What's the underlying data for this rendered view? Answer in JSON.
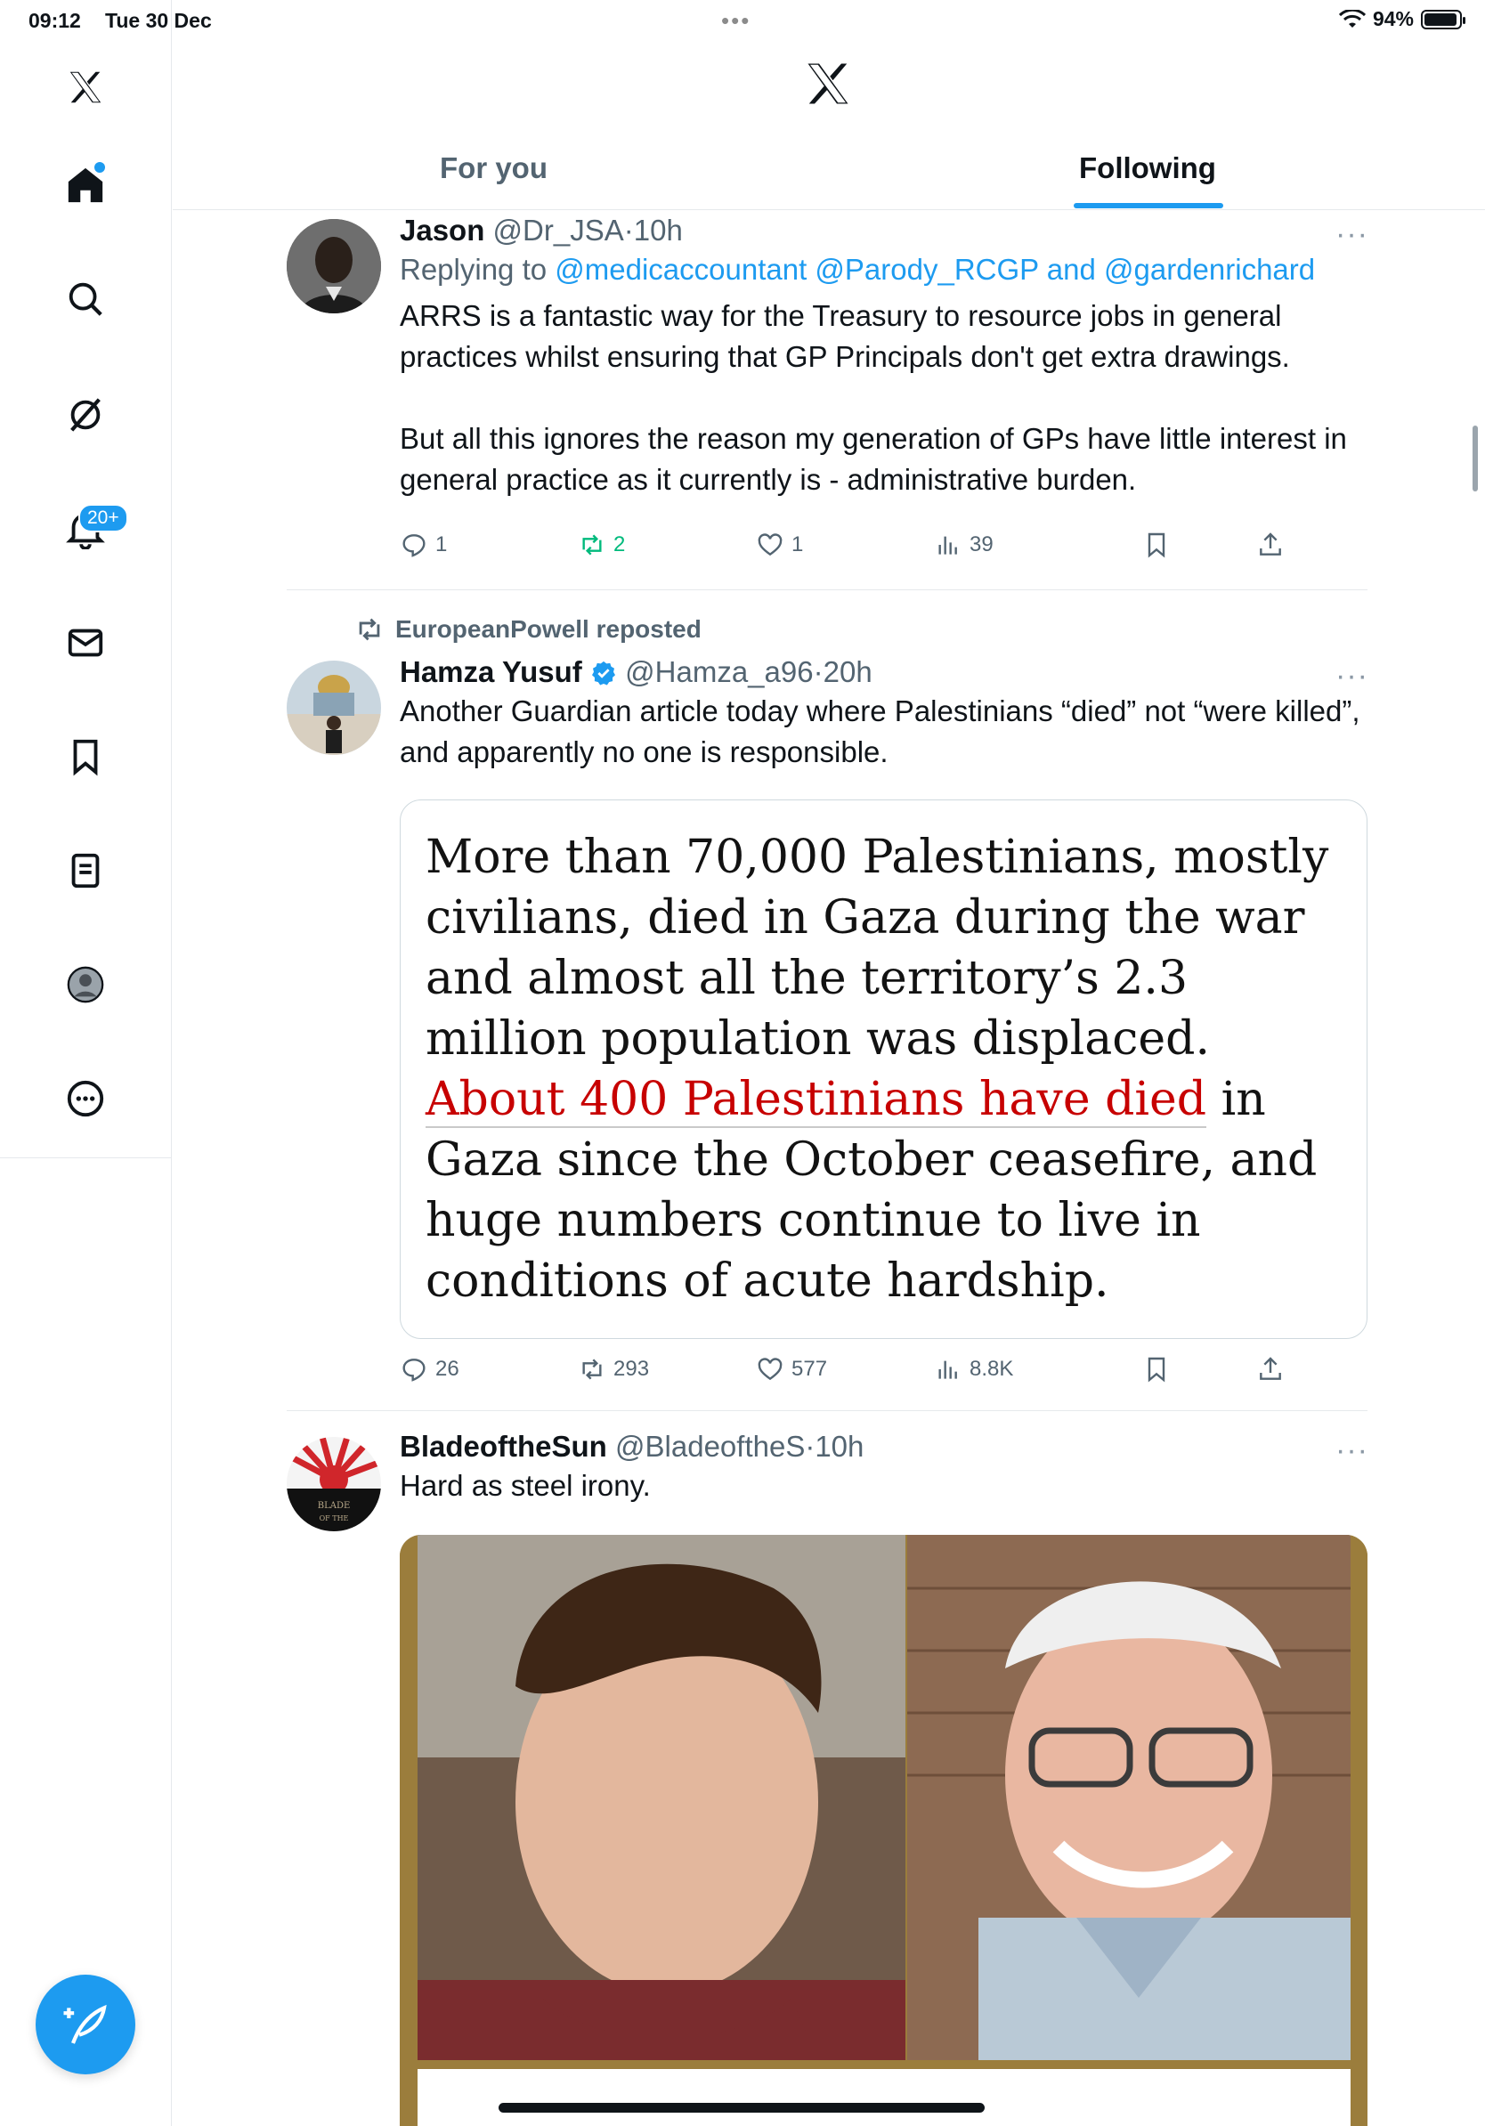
{
  "status_bar": {
    "time": "09:12",
    "date": "Tue 30 Dec",
    "battery": "94%",
    "battery_level": 0.94
  },
  "header": {
    "logo": "x-logo-icon"
  },
  "tabs": [
    {
      "label": "For you"
    },
    {
      "label": "Following"
    }
  ],
  "sidebar": {
    "items": [
      {
        "name": "home",
        "icon": "home-icon"
      },
      {
        "name": "search",
        "icon": "search-icon"
      },
      {
        "name": "grok",
        "icon": "grok-icon"
      },
      {
        "name": "notifications",
        "icon": "bell-icon",
        "badge": "20+"
      },
      {
        "name": "messages",
        "icon": "mail-icon"
      },
      {
        "name": "bookmarks",
        "icon": "bookmark-icon"
      },
      {
        "name": "lists",
        "icon": "list-icon"
      },
      {
        "name": "profile",
        "icon": "profile-icon"
      },
      {
        "name": "more",
        "icon": "more-icon"
      }
    ],
    "compose": "compose-icon"
  },
  "tweets": [
    {
      "name": "Jason",
      "handle": "@Dr_JSA",
      "time": "10h",
      "replying_prefix": "Replying to ",
      "mention1": "@medicaccountant",
      "mention2": "@Parody_RCGP",
      "and": "and",
      "mention3": "@gardenrichard",
      "text1": "ARRS is a fantastic way for the Treasury to resource jobs in general practices whilst ensuring that GP Principals don't get extra drawings.",
      "text2": "But all this ignores the reason my generation of GPs have little interest in general practice as it currently is - administrative burden.",
      "replies": "1",
      "reposts": "2",
      "likes": "1",
      "views": "39"
    },
    {
      "reposted_by": "EuropeanPowell reposted",
      "name": "Hamza Yusuf",
      "verified": true,
      "handle": "@Hamza_a96",
      "time": "20h",
      "text": "Another Guardian article today where Palestinians “died” not “were killed”, and apparently no one is responsible.",
      "quote_part1": "More than 70,000 Palestinians, mostly civilians, died in Gaza during the war and almost all the territory’s 2.3 million population was displaced.",
      "quote_link": "About 400 Palestinians have died",
      "quote_part2": "in Gaza since the October ceasefire, and huge numbers continue to live in conditions of acute hardship.",
      "replies": "26",
      "reposts": "293",
      "likes": "577",
      "views": "8.8K"
    },
    {
      "name": "BladeoftheSun",
      "handle": "@BladeoftheS",
      "time": "10h",
      "text": "Hard as steel irony.",
      "avatar_text": "BLADE OF THE SUN"
    }
  ],
  "separator_dot": "·",
  "more_dots": "···",
  "colors": {
    "accent": "#1d9bf0",
    "repost_green": "#00ba7c",
    "quote_link": "#c70000"
  }
}
